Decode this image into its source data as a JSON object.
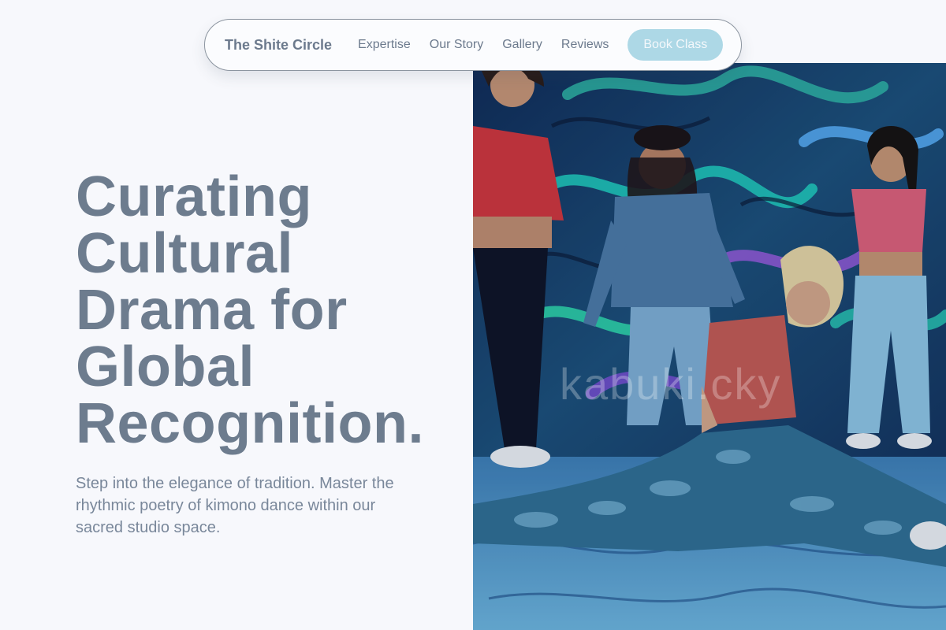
{
  "nav": {
    "brand": "The Shite Circle",
    "links": [
      "Expertise",
      "Our Story",
      "Gallery",
      "Reviews"
    ],
    "cta_label": "Book Class"
  },
  "hero": {
    "title_lines": [
      "Curating",
      "Cultural",
      "Drama for",
      "Global",
      "Recognition."
    ],
    "subtitle": "Step into the elegance of tradition. Master the rhythmic poetry of kimono dance within our sacred studio space.",
    "image_watermark": "kabuki.cky"
  },
  "colors": {
    "background": "#f7f8fc",
    "text": "#6d7c8e",
    "cta_bg": "#add8e6",
    "cta_text": "#f4f8fb"
  }
}
